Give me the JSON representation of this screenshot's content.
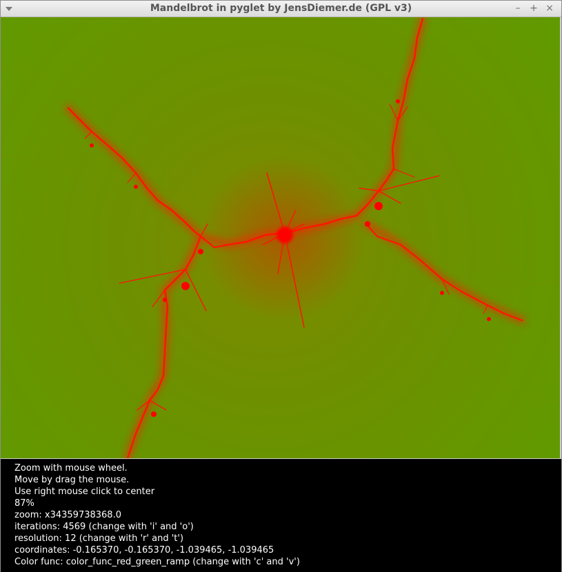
{
  "window": {
    "title": "Mandelbrot in pyglet by JensDiemer.de (GPL v3)",
    "menu_icon": "chevron-down-icon",
    "minimize_glyph": "–",
    "maximize_glyph": "+",
    "close_glyph": "×"
  },
  "fractal": {
    "background_color": "#629a00",
    "filament_color": "#ff0000"
  },
  "info": {
    "help_zoom": "Zoom with mouse wheel.",
    "help_move": "Move by drag the mouse.",
    "help_center": "Use right mouse click to center",
    "progress": "87%",
    "zoom": "zoom: x34359738368.0",
    "iterations": "iterations: 4569 (change with 'i' and 'o')",
    "resolution": "resolution: 12 (change with 'r' and 't')",
    "coordinates": "coordinates: -0.165370, -0.165370, -1.039465, -1.039465",
    "color_func": "Color func: color_func_red_green_ramp (change with 'c' and 'v')"
  }
}
